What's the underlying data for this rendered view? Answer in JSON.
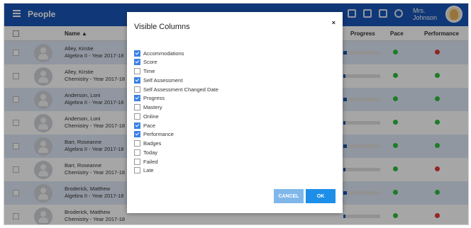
{
  "app": {
    "title": "People",
    "user_name_line1": "Mrs.",
    "user_name_line2": "Johnson"
  },
  "table": {
    "headers": {
      "name": "Name ▲",
      "progress": "Progress",
      "pace": "Pace",
      "performance": "Performance"
    },
    "rows": [
      {
        "name": "Alley, Kirstie",
        "course": "Algebra II - Year 2017-18",
        "progress": 0.09,
        "pace": "green",
        "performance": "red"
      },
      {
        "name": "Alley, Kirstie",
        "course": "Chemistry - Year 2017-18",
        "progress": 0.05,
        "pace": "green",
        "performance": "green"
      },
      {
        "name": "Anderson, Loni",
        "course": "Algebra II - Year 2017-18",
        "progress": 0.09,
        "pace": "green",
        "performance": "green"
      },
      {
        "name": "Anderson, Loni",
        "course": "Chemistry - Year 2017-18",
        "progress": 0.05,
        "pace": "green",
        "performance": "green"
      },
      {
        "name": "Barr, Roseanne",
        "course": "Algebra II - Year 2017-18",
        "progress": 0.09,
        "pace": "green",
        "performance": "green"
      },
      {
        "name": "Barr, Roseanne",
        "course": "Chemistry - Year 2017-18",
        "progress": 0.05,
        "pace": "green",
        "performance": "red"
      },
      {
        "name": "Broderick, Matthew",
        "course": "Algebra II - Year 2017-18",
        "progress": 0.09,
        "pace": "green",
        "performance": "green"
      },
      {
        "name": "Broderick, Matthew",
        "course": "Chemistry - Year 2017-18",
        "progress": 0.05,
        "pace": "green",
        "performance": "red"
      }
    ]
  },
  "modal": {
    "title": "Visible Columns",
    "close": "×",
    "options": [
      {
        "label": "Accommodations",
        "checked": true
      },
      {
        "label": "Score",
        "checked": true
      },
      {
        "label": "Time",
        "checked": false
      },
      {
        "label": "Self Assessment",
        "checked": true
      },
      {
        "label": "Self Assessment Changed Date",
        "checked": false
      },
      {
        "label": "Progress",
        "checked": true
      },
      {
        "label": "Mastery",
        "checked": false
      },
      {
        "label": "Online",
        "checked": false
      },
      {
        "label": "Pace",
        "checked": true
      },
      {
        "label": "Performance",
        "checked": true
      },
      {
        "label": "Badges",
        "checked": false
      },
      {
        "label": "Today",
        "checked": false
      },
      {
        "label": "Failed",
        "checked": false
      },
      {
        "label": "Late",
        "checked": false
      }
    ],
    "cancel_label": "CANCEL",
    "ok_label": "OK"
  }
}
